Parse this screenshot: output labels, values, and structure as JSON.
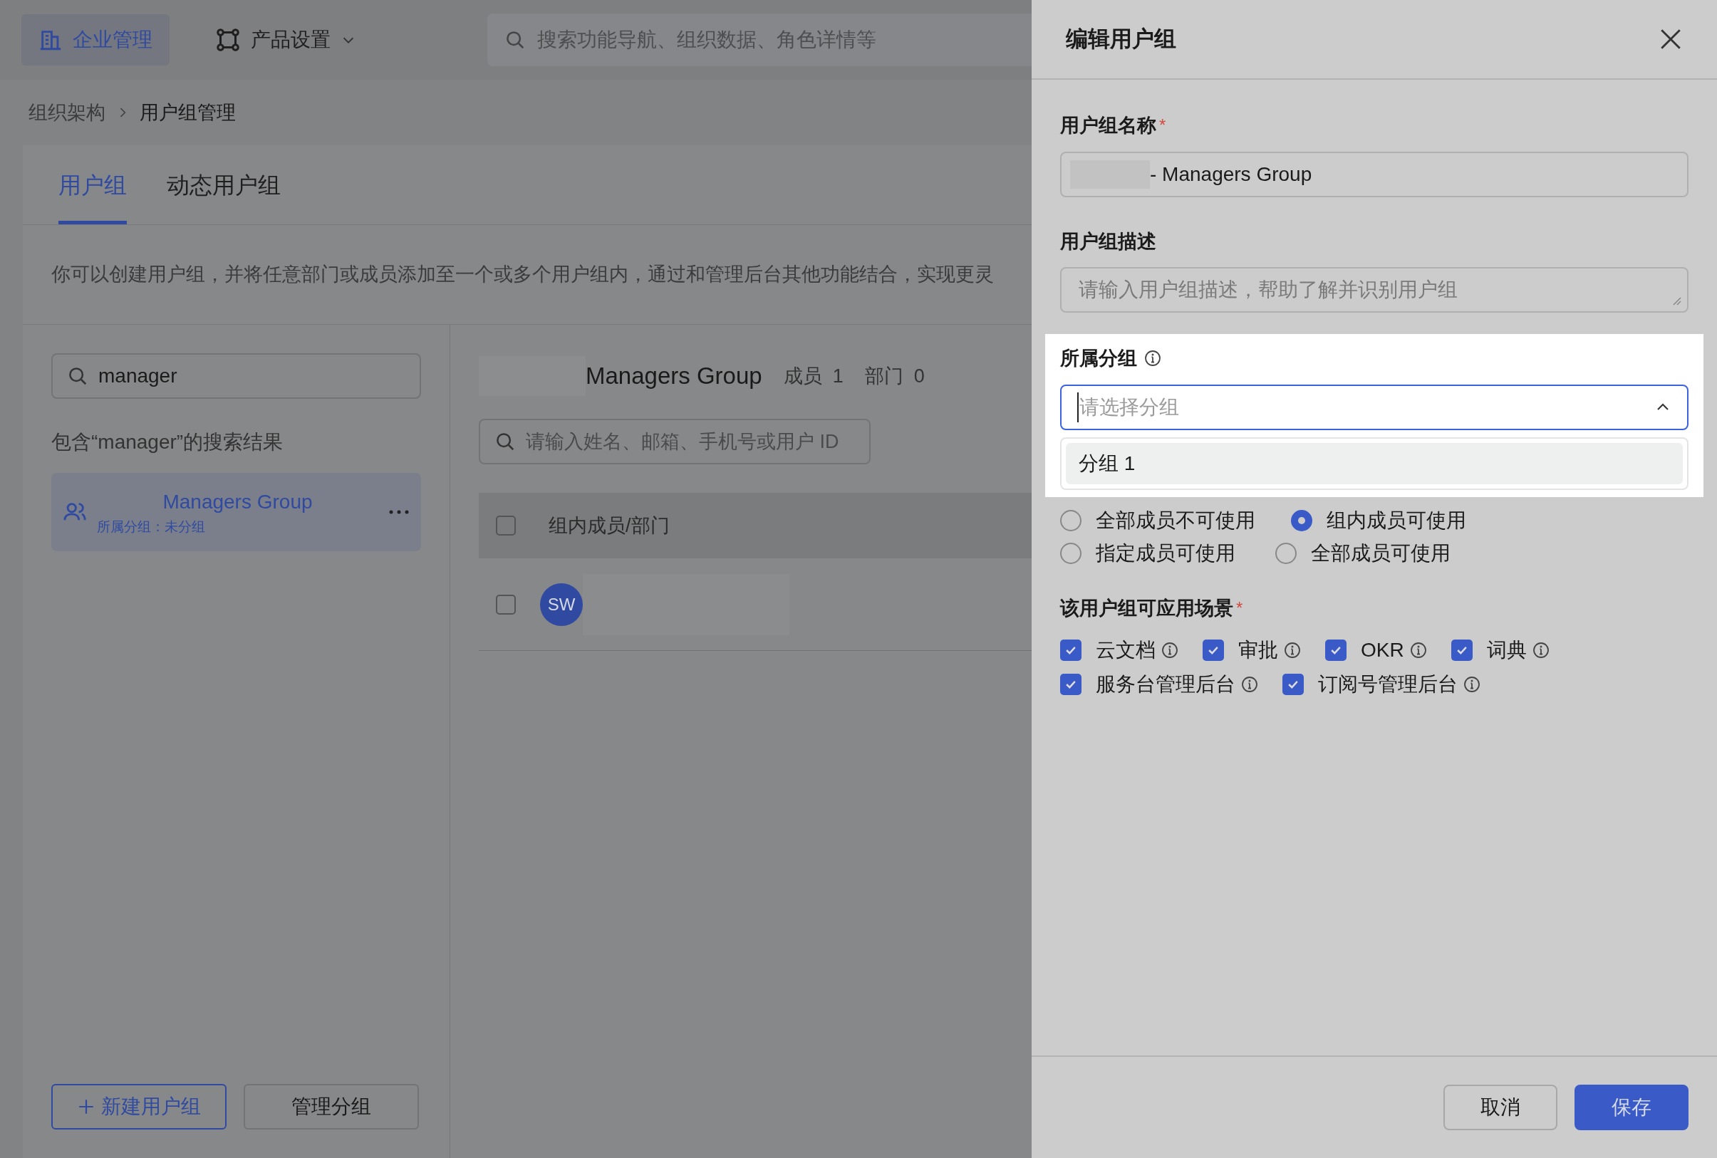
{
  "top_bar": {
    "nav": [
      {
        "label": "企业管理",
        "selected": true
      },
      {
        "label": "产品设置",
        "selected": false
      }
    ],
    "search": {
      "placeholder": "搜索功能导航、组织数据、角色详情等"
    }
  },
  "breadcrumb": [
    "组织架构",
    "用户组管理"
  ],
  "tabs": [
    {
      "label": "用户组",
      "selected": true
    },
    {
      "label": "动态用户组",
      "selected": false
    }
  ],
  "description": "你可以创建用户组，并将任意部门或成员添加至一个或多个用户组内，通过和管理后台其他功能结合，实现更灵",
  "group_list": {
    "search": {
      "value": "manager"
    },
    "result_caption": "包含“manager”的搜索结果",
    "items": [
      {
        "name": "Managers Group",
        "subgroup": "所属分组：未分组",
        "selected": true
      }
    ],
    "buttons": [
      "新建用户组",
      "管理分组"
    ]
  },
  "group_detail": {
    "title": "Managers Group",
    "counts": [
      {
        "label": "成员",
        "value": "1"
      },
      {
        "label": "部门",
        "value": "0"
      }
    ],
    "search": {
      "placeholder": "请输入姓名、邮箱、手机号或用户 ID"
    },
    "column": "组内成员/部门",
    "select_all_checked": false,
    "rows": [
      {
        "avatar": "SW",
        "checked": false
      }
    ]
  },
  "drawer": {
    "title": "编辑用户组",
    "name_field": {
      "label": "用户组名称",
      "required_mark": "*",
      "value": "- Managers Group"
    },
    "description_field": {
      "label": "用户组描述",
      "placeholder": "请输入用户组描述，帮助了解并识别用户组"
    },
    "subgroup_field": {
      "label": "所属分组",
      "placeholder": "请选择分组",
      "expanded": true,
      "options": [
        {
          "label": "分组 1",
          "selected": false
        }
      ]
    },
    "usage_options": [
      {
        "label": "全部成员不可使用",
        "selected": false
      },
      {
        "label": "组内成员可使用",
        "selected": true
      },
      {
        "label": "指定成员可使用",
        "selected": false
      },
      {
        "label": "全部成员可使用",
        "selected": false
      }
    ],
    "scenes": {
      "label": "该用户组可应用场景",
      "required_mark": "*",
      "items": [
        {
          "label": "云文档",
          "checked": true
        },
        {
          "label": "审批",
          "checked": true
        },
        {
          "label": "OKR",
          "checked": true
        },
        {
          "label": "词典",
          "checked": true
        },
        {
          "label": "服务台管理后台",
          "checked": true
        },
        {
          "label": "订阅号管理后台",
          "checked": true
        }
      ]
    },
    "buttons": [
      {
        "label": "取消",
        "kind": "secondary"
      },
      {
        "label": "保存",
        "kind": "primary"
      }
    ]
  }
}
